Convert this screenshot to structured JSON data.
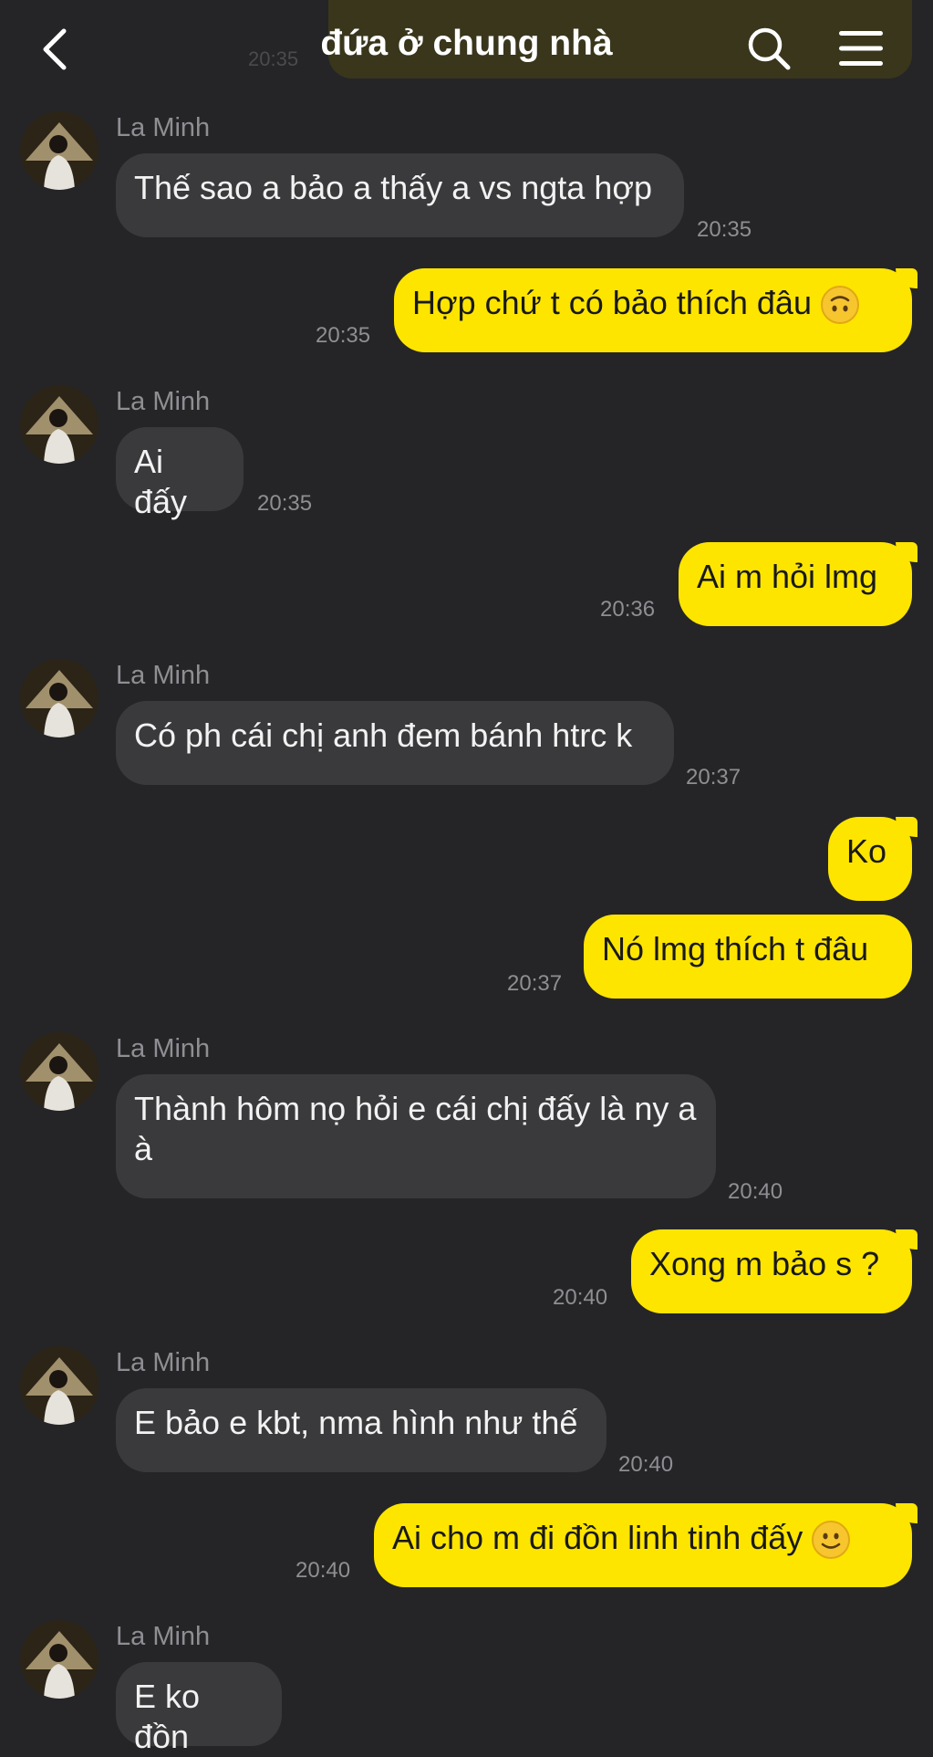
{
  "header": {
    "title": "đứa ở chung nhà",
    "ghost_time": "20:35"
  },
  "colors": {
    "background": "#252527",
    "incoming_bubble": "#3a3a3c",
    "outgoing_bubble": "#fee500",
    "timestamp": "#8e8e93"
  },
  "messages": [
    {
      "sender": "La Minh",
      "text": "Thế sao a bảo a thấy a vs ngta hợp",
      "time": "20:35"
    },
    {
      "text": "Hợp chứ t có bảo thích đâu",
      "emoji": "upside-down-face-emoji",
      "time": "20:35"
    },
    {
      "sender": "La Minh",
      "text": "Ai đấy",
      "time": "20:35"
    },
    {
      "text": "Ai m hỏi lmg",
      "time": "20:36"
    },
    {
      "sender": "La Minh",
      "text": "Có ph cái chị anh đem bánh htrc k",
      "time": "20:37"
    },
    {
      "text": "Ko"
    },
    {
      "text": "Nó lmg thích t đâu",
      "time": "20:37"
    },
    {
      "sender": "La Minh",
      "text": "Thành hôm nọ hỏi e cái chị đấy là ny a à",
      "time": "20:40"
    },
    {
      "text": "Xong m bảo s ?",
      "time": "20:40"
    },
    {
      "sender": "La Minh",
      "text": "E bảo e kbt, nma hình như thế",
      "time": "20:40"
    },
    {
      "text": "Ai cho m đi đồn linh tinh đấy",
      "emoji": "slightly-smiling-face-emoji",
      "time": "20:40"
    },
    {
      "sender": "La Minh",
      "text": "E ko đồn"
    }
  ]
}
